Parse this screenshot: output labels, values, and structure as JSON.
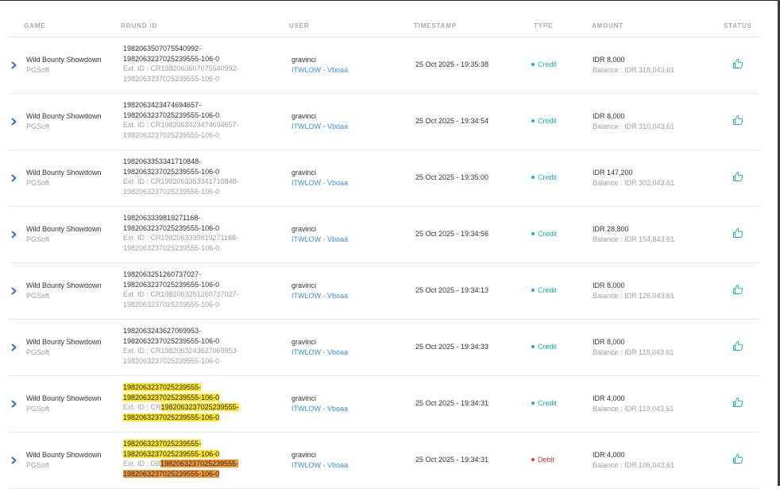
{
  "columns": {
    "game": "GAME",
    "round_id": "ROUND ID",
    "user": "USER",
    "timestamp": "TIMESTAMP",
    "type": "TYPE",
    "amount": "AMOUNT",
    "status": "STATUS"
  },
  "colors": {
    "credit": "#17b5b5",
    "debit": "#e2353e",
    "link": "#3a8fd9",
    "highlight_yellow": "#ffe629",
    "highlight_orange": "#f29a3a"
  },
  "icons": {
    "expand": "chevron-right-icon",
    "status": "thumbs-up-icon"
  },
  "rows": [
    {
      "game": "Wild Bounty Showdown",
      "provider": "PGSoft",
      "round_line1": "1982063507075540992-",
      "round_line2": "1982063237025239555-106-0",
      "ext_prefix": "Ext. ID : ",
      "ext_line1": "CR1982063507075540992-",
      "ext_line2": "1982063237025239555-106-0",
      "user": "gravinci",
      "agent": "ITWLOW - Vboaa",
      "timestamp": "25 Oct 2025 - 19:35:38",
      "type": "Credit",
      "amount": "IDR 8,000",
      "balance": "Balance : IDR 318,043.61"
    },
    {
      "game": "Wild Bounty Showdown",
      "provider": "PGSoft",
      "round_line1": "1982063423474694657-",
      "round_line2": "1982063237025239555-106-0",
      "ext_prefix": "Ext. ID : ",
      "ext_line1": "CR1982063423474694657-",
      "ext_line2": "1982063237025239555-106-0",
      "user": "gravinci",
      "agent": "ITWLOW - Vboaa",
      "timestamp": "25 Oct 2025 - 19:34:54",
      "type": "Credit",
      "amount": "IDR 8,000",
      "balance": "Balance : IDR 310,043.61"
    },
    {
      "game": "Wild Bounty Showdown",
      "provider": "PGSoft",
      "round_line1": "1982063353341710848-",
      "round_line2": "1982063237025239555-106-0",
      "ext_prefix": "Ext. ID : ",
      "ext_line1": "CR1982063353341710848-",
      "ext_line2": "1982063237025239555-106-0",
      "user": "gravinci",
      "agent": "ITWLOW - Vboaa",
      "timestamp": "25 Oct 2025 - 19:35:00",
      "type": "Credit",
      "amount": "IDR 147,200",
      "balance": "Balance : IDR 302,043.61"
    },
    {
      "game": "Wild Bounty Showdown",
      "provider": "PGSoft",
      "round_line1": "1982063339819271168-",
      "round_line2": "1982063237025239555-106-0",
      "ext_prefix": "Ext. ID : ",
      "ext_line1": "CR1982063339819271168-",
      "ext_line2": "1982063237025239555-106-0",
      "user": "gravinci",
      "agent": "ITWLOW - Vboaa",
      "timestamp": "25 Oct 2025 - 19:34:56",
      "type": "Credit",
      "amount": "IDR 28,800",
      "balance": "Balance : IDR 154,843.61"
    },
    {
      "game": "Wild Bounty Showdown",
      "provider": "PGSoft",
      "round_line1": "1982063251260737027-",
      "round_line2": "1982063237025239555-106-0",
      "ext_prefix": "Ext. ID : ",
      "ext_line1": "CR1982063251260737027-",
      "ext_line2": "1982063237025239555-106-0",
      "user": "gravinci",
      "agent": "ITWLOW - Vboaa",
      "timestamp": "25 Oct 2025 - 19:34:13",
      "type": "Credit",
      "amount": "IDR 8,000",
      "balance": "Balance : IDR 126,043.61"
    },
    {
      "game": "Wild Bounty Showdown",
      "provider": "PGSoft",
      "round_line1": "1982063243627069953-",
      "round_line2": "1982063237025239555-106-0",
      "ext_prefix": "Ext. ID : ",
      "ext_line1": "CR1982063243627069953-",
      "ext_line2": "1982063237025239555-106-0",
      "user": "gravinci",
      "agent": "ITWLOW - Vboaa",
      "timestamp": "25 Oct 2025 - 19:34:33",
      "type": "Credit",
      "amount": "IDR 8,000",
      "balance": "Balance : IDR 118,043.61"
    },
    {
      "game": "Wild Bounty Showdown",
      "provider": "PGSoft",
      "round_line1": "1982063237025239555-",
      "round_line2": "1982063237025239555-106-0",
      "ext_prefix": "Ext. ID : CR",
      "ext_line1": "1982063237025239555-",
      "ext_line2": "1982063237025239555-106-0",
      "user": "gravinci",
      "agent": "ITWLOW - Vboaa",
      "timestamp": "25 Oct 2025 - 19:34:31",
      "type": "Credit",
      "amount": "IDR 4,000",
      "balance": "Balance : IDR 110,043.61"
    },
    {
      "game": "Wild Bounty Showdown",
      "provider": "PGSoft",
      "round_line1": "1982063237025239555-",
      "round_line2": "1982063237025239555-106-0",
      "ext_prefix": "Ext. ID : DB",
      "ext_line1": "1982063237025239555-",
      "ext_line2": "1982063237025239555-106-0",
      "user": "gravinci",
      "agent": "ITWLOW - Vboaa",
      "timestamp": "25 Oct 2025 - 19:34:31",
      "type": "Debit",
      "amount": "IDR 4,000",
      "balance": "Balance : IDR 106,043.61"
    }
  ]
}
